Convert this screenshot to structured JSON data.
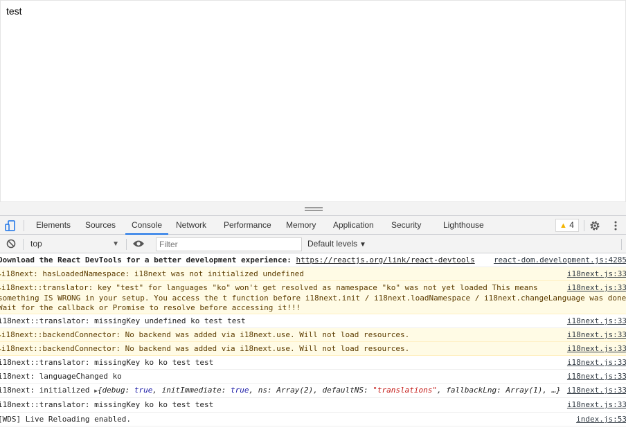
{
  "page": {
    "text": "test"
  },
  "devtools": {
    "tabs": [
      "Elements",
      "Sources",
      "Console",
      "Network",
      "Performance",
      "Memory",
      "Application",
      "Security",
      "Lighthouse"
    ],
    "active_tab": "Console",
    "warning_count": "4",
    "context": "top",
    "filter_placeholder": "Filter",
    "levels": "Default levels",
    "accent": "#1a73e8"
  },
  "console": {
    "messages": [
      {
        "level": "info",
        "text_bold": "Download the React DevTools for a better development experience: ",
        "link": "https://reactjs.org/link/react-devtools",
        "source": "react-dom.development.js:4285"
      },
      {
        "level": "warning",
        "text": "i18next: hasLoadedNamespace: i18next was not initialized undefined",
        "source": "i18next.js:33"
      },
      {
        "level": "warning",
        "lines": [
          "i18next::translator: key \"test\" for languages \"ko\" won't get resolved as namespace \"ko\" was not yet loaded This means",
          "something IS WRONG in your setup. You access the t function before i18next.init / i18next.loadNamespace / i18next.changeLanguage was done.",
          "Wait for the callback or Promise to resolve before accessing it!!!"
        ],
        "source": "i18next.js:33"
      },
      {
        "level": "info",
        "text": "i18next::translator: missingKey undefined ko test test",
        "source": "i18next.js:33"
      },
      {
        "level": "warning",
        "text": "i18next::backendConnector: No backend was added via i18next.use. Will not load resources.",
        "source": "i18next.js:33"
      },
      {
        "level": "warning",
        "text": "i18next::backendConnector: No backend was added via i18next.use. Will not load resources.",
        "source": "i18next.js:33"
      },
      {
        "level": "info",
        "text": "i18next::translator: missingKey ko ko test test",
        "source": "i18next.js:33"
      },
      {
        "level": "info",
        "text": "i18next: languageChanged ko",
        "source": "i18next.js:33"
      },
      {
        "level": "info",
        "text": "i18next: initialized ",
        "object_preview": "{debug: true, initImmediate: true, ns: Array(2), defaultNS: \"translations\", fallbackLng: Array(1), …}",
        "source": "i18next.js:33"
      },
      {
        "level": "info",
        "text": "i18next::translator: missingKey ko ko test test",
        "source": "i18next.js:33"
      },
      {
        "level": "info",
        "text": "[WDS] Live Reloading enabled.",
        "source": "index.js:53"
      }
    ]
  }
}
